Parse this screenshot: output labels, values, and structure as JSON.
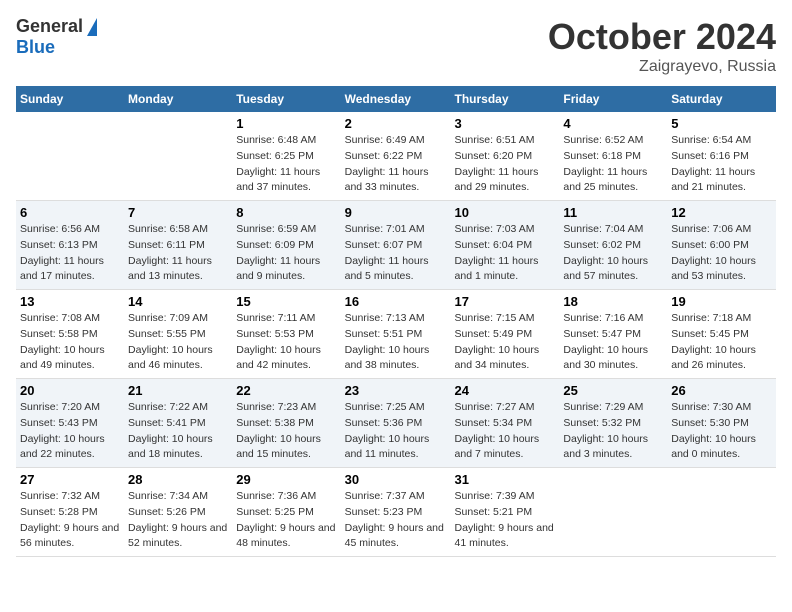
{
  "header": {
    "logo_general": "General",
    "logo_blue": "Blue",
    "title": "October 2024",
    "location": "Zaigrayevo, Russia"
  },
  "days_of_week": [
    "Sunday",
    "Monday",
    "Tuesday",
    "Wednesday",
    "Thursday",
    "Friday",
    "Saturday"
  ],
  "weeks": [
    [
      {
        "day": "",
        "detail": ""
      },
      {
        "day": "",
        "detail": ""
      },
      {
        "day": "1",
        "detail": "Sunrise: 6:48 AM\nSunset: 6:25 PM\nDaylight: 11 hours and 37 minutes."
      },
      {
        "day": "2",
        "detail": "Sunrise: 6:49 AM\nSunset: 6:22 PM\nDaylight: 11 hours and 33 minutes."
      },
      {
        "day": "3",
        "detail": "Sunrise: 6:51 AM\nSunset: 6:20 PM\nDaylight: 11 hours and 29 minutes."
      },
      {
        "day": "4",
        "detail": "Sunrise: 6:52 AM\nSunset: 6:18 PM\nDaylight: 11 hours and 25 minutes."
      },
      {
        "day": "5",
        "detail": "Sunrise: 6:54 AM\nSunset: 6:16 PM\nDaylight: 11 hours and 21 minutes."
      }
    ],
    [
      {
        "day": "6",
        "detail": "Sunrise: 6:56 AM\nSunset: 6:13 PM\nDaylight: 11 hours and 17 minutes."
      },
      {
        "day": "7",
        "detail": "Sunrise: 6:58 AM\nSunset: 6:11 PM\nDaylight: 11 hours and 13 minutes."
      },
      {
        "day": "8",
        "detail": "Sunrise: 6:59 AM\nSunset: 6:09 PM\nDaylight: 11 hours and 9 minutes."
      },
      {
        "day": "9",
        "detail": "Sunrise: 7:01 AM\nSunset: 6:07 PM\nDaylight: 11 hours and 5 minutes."
      },
      {
        "day": "10",
        "detail": "Sunrise: 7:03 AM\nSunset: 6:04 PM\nDaylight: 11 hours and 1 minute."
      },
      {
        "day": "11",
        "detail": "Sunrise: 7:04 AM\nSunset: 6:02 PM\nDaylight: 10 hours and 57 minutes."
      },
      {
        "day": "12",
        "detail": "Sunrise: 7:06 AM\nSunset: 6:00 PM\nDaylight: 10 hours and 53 minutes."
      }
    ],
    [
      {
        "day": "13",
        "detail": "Sunrise: 7:08 AM\nSunset: 5:58 PM\nDaylight: 10 hours and 49 minutes."
      },
      {
        "day": "14",
        "detail": "Sunrise: 7:09 AM\nSunset: 5:55 PM\nDaylight: 10 hours and 46 minutes."
      },
      {
        "day": "15",
        "detail": "Sunrise: 7:11 AM\nSunset: 5:53 PM\nDaylight: 10 hours and 42 minutes."
      },
      {
        "day": "16",
        "detail": "Sunrise: 7:13 AM\nSunset: 5:51 PM\nDaylight: 10 hours and 38 minutes."
      },
      {
        "day": "17",
        "detail": "Sunrise: 7:15 AM\nSunset: 5:49 PM\nDaylight: 10 hours and 34 minutes."
      },
      {
        "day": "18",
        "detail": "Sunrise: 7:16 AM\nSunset: 5:47 PM\nDaylight: 10 hours and 30 minutes."
      },
      {
        "day": "19",
        "detail": "Sunrise: 7:18 AM\nSunset: 5:45 PM\nDaylight: 10 hours and 26 minutes."
      }
    ],
    [
      {
        "day": "20",
        "detail": "Sunrise: 7:20 AM\nSunset: 5:43 PM\nDaylight: 10 hours and 22 minutes."
      },
      {
        "day": "21",
        "detail": "Sunrise: 7:22 AM\nSunset: 5:41 PM\nDaylight: 10 hours and 18 minutes."
      },
      {
        "day": "22",
        "detail": "Sunrise: 7:23 AM\nSunset: 5:38 PM\nDaylight: 10 hours and 15 minutes."
      },
      {
        "day": "23",
        "detail": "Sunrise: 7:25 AM\nSunset: 5:36 PM\nDaylight: 10 hours and 11 minutes."
      },
      {
        "day": "24",
        "detail": "Sunrise: 7:27 AM\nSunset: 5:34 PM\nDaylight: 10 hours and 7 minutes."
      },
      {
        "day": "25",
        "detail": "Sunrise: 7:29 AM\nSunset: 5:32 PM\nDaylight: 10 hours and 3 minutes."
      },
      {
        "day": "26",
        "detail": "Sunrise: 7:30 AM\nSunset: 5:30 PM\nDaylight: 10 hours and 0 minutes."
      }
    ],
    [
      {
        "day": "27",
        "detail": "Sunrise: 7:32 AM\nSunset: 5:28 PM\nDaylight: 9 hours and 56 minutes."
      },
      {
        "day": "28",
        "detail": "Sunrise: 7:34 AM\nSunset: 5:26 PM\nDaylight: 9 hours and 52 minutes."
      },
      {
        "day": "29",
        "detail": "Sunrise: 7:36 AM\nSunset: 5:25 PM\nDaylight: 9 hours and 48 minutes."
      },
      {
        "day": "30",
        "detail": "Sunrise: 7:37 AM\nSunset: 5:23 PM\nDaylight: 9 hours and 45 minutes."
      },
      {
        "day": "31",
        "detail": "Sunrise: 7:39 AM\nSunset: 5:21 PM\nDaylight: 9 hours and 41 minutes."
      },
      {
        "day": "",
        "detail": ""
      },
      {
        "day": "",
        "detail": ""
      }
    ]
  ]
}
